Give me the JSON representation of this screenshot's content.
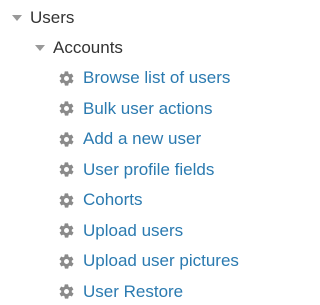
{
  "tree": {
    "root": {
      "label": "Users",
      "expanded": true,
      "icon": "caret-down-icon"
    },
    "category": {
      "label": "Accounts",
      "expanded": true,
      "icon": "caret-down-icon"
    },
    "items": [
      {
        "label": "Browse list of users",
        "icon": "gear-icon"
      },
      {
        "label": "Bulk user actions",
        "icon": "gear-icon"
      },
      {
        "label": "Add a new user",
        "icon": "gear-icon"
      },
      {
        "label": "User profile fields",
        "icon": "gear-icon"
      },
      {
        "label": "Cohorts",
        "icon": "gear-icon"
      },
      {
        "label": "Upload users",
        "icon": "gear-icon"
      },
      {
        "label": "Upload user pictures",
        "icon": "gear-icon"
      },
      {
        "label": "User Restore",
        "icon": "gear-icon"
      }
    ]
  },
  "colors": {
    "link": "#2a7ab0",
    "text": "#333333",
    "icon": "#8a8a8a"
  }
}
